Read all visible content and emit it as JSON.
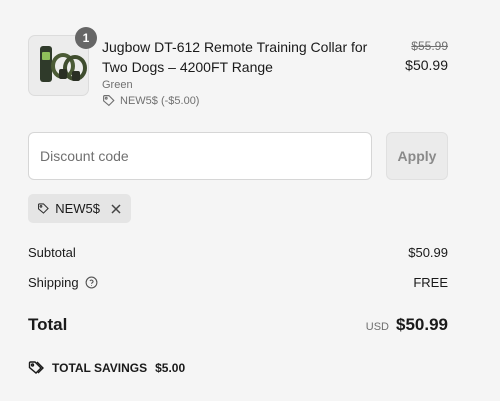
{
  "line_item": {
    "quantity": "1",
    "title": "Jugbow DT-612 Remote Training Collar for Two Dogs – 4200FT Range",
    "variant": "Green",
    "discount": "NEW5$ (-$5.00)",
    "compare_price": "$55.99",
    "price": "$50.99",
    "image_icon": "product-thumbnail"
  },
  "discount_form": {
    "placeholder": "Discount code",
    "value": "",
    "apply_label": "Apply"
  },
  "applied_code": {
    "code": "NEW5$",
    "icon": "tag-icon",
    "remove_icon": "close-icon"
  },
  "summary": {
    "subtotal_label": "Subtotal",
    "subtotal_value": "$50.99",
    "shipping_label": "Shipping",
    "shipping_value": "FREE",
    "total_label": "Total",
    "currency": "USD",
    "total_value": "$50.99"
  },
  "savings": {
    "label": "TOTAL SAVINGS",
    "amount": "$5.00"
  },
  "colors": {
    "background": "#f5f5f5",
    "muted_text": "#707070",
    "badge": "#666666"
  }
}
